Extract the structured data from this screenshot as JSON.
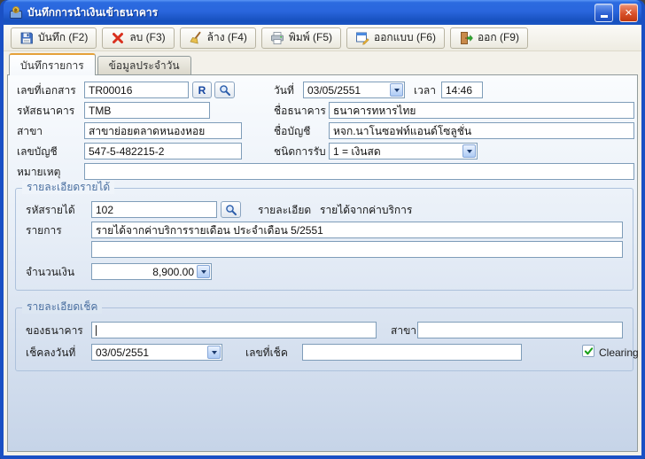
{
  "window": {
    "title": "บันทึกการนำเงินเข้าธนาคาร"
  },
  "toolbar": {
    "buttons": [
      {
        "label": "บันทึก (F2)"
      },
      {
        "label": "ลบ (F3)"
      },
      {
        "label": "ล้าง (F4)"
      },
      {
        "label": "พิมพ์ (F5)"
      },
      {
        "label": "ออกแบบ (F6)"
      },
      {
        "label": "ออก (F9)"
      }
    ]
  },
  "tabs": [
    {
      "label": "บันทึกรายการ"
    },
    {
      "label": "ข้อมูลประจำวัน"
    }
  ],
  "form": {
    "doc_no": {
      "label": "เลขที่เอกสาร",
      "value": "TR00016"
    },
    "r_button_label": "R",
    "date": {
      "label": "วันที่",
      "value": "03/05/2551"
    },
    "time": {
      "label": "เวลา",
      "value": "14:46"
    },
    "bank_code": {
      "label": "รหัสธนาคาร",
      "value": "TMB"
    },
    "bank_name": {
      "label": "ชื่อธนาคาร",
      "value": "ธนาคารทหารไทย"
    },
    "branch": {
      "label": "สาขา",
      "value": "สาขาย่อยตลาดหนองหอย"
    },
    "account_name": {
      "label": "ชื่อบัญชี",
      "value": "หจก.นาโนซอฟท์แอนด์โซลูชั่น"
    },
    "account_no": {
      "label": "เลขบัญชี",
      "value": "547-5-482215-2"
    },
    "receive_type": {
      "label": "ชนิดการรับ",
      "value": "1 = เงินสด"
    },
    "remark": {
      "label": "หมายเหตุ",
      "value": ""
    }
  },
  "income": {
    "title": "รายละเอียดรายได้",
    "income_code": {
      "label": "รหัสรายได้",
      "value": "102"
    },
    "detail": {
      "label": "รายละเอียด",
      "value": "รายได้จากค่าบริการ"
    },
    "item": {
      "label": "รายการ",
      "value": "รายได้จากค่าบริการรายเดือน ประจำเดือน 5/2551"
    },
    "item2": {
      "value": ""
    },
    "amount": {
      "label": "จำนวนเงิน",
      "value": "8,900.00"
    }
  },
  "cheque": {
    "title": "รายละเอียดเช็ค",
    "of_bank": {
      "label": "ของธนาคาร",
      "value": ""
    },
    "branch": {
      "label": "สาขา",
      "value": ""
    },
    "cheque_date": {
      "label": "เช็คลงวันที่",
      "value": "03/05/2551"
    },
    "cheque_no": {
      "label": "เลขที่เช็ค",
      "value": ""
    },
    "clearing": {
      "label": "Clearing",
      "checked": true
    }
  },
  "colors": {
    "titlebar_blue": "#2a66dd",
    "panel_bottom_blue": "#c6d4e8",
    "field_border": "#7f9db9",
    "group_title": "#4a6fa0",
    "clearing_check_green": "#18a018",
    "close_red": "#c0380f"
  }
}
